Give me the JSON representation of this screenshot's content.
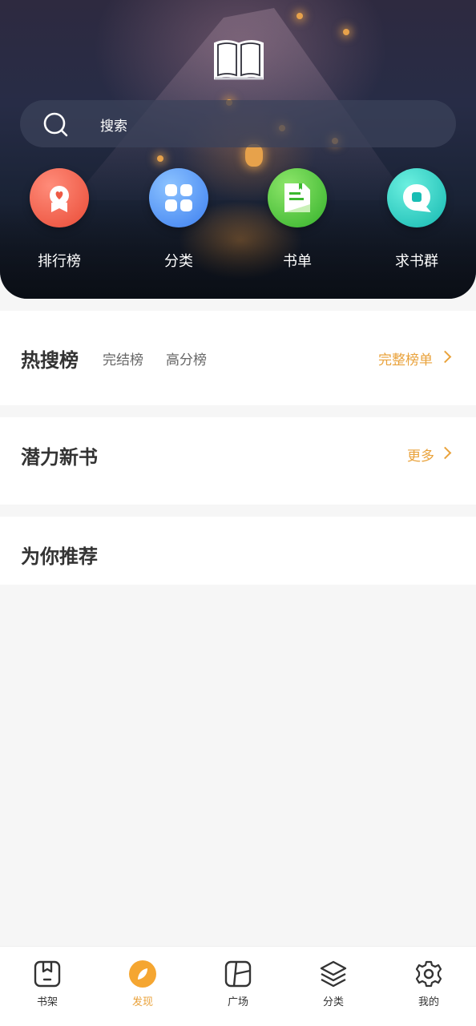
{
  "search": {
    "placeholder": "搜索"
  },
  "quick_entries": [
    {
      "label": "排行榜",
      "icon": "ranking-badge-icon",
      "color": "#e94b36"
    },
    {
      "label": "分类",
      "icon": "category-grid-icon",
      "color": "#3d7ff0"
    },
    {
      "label": "书单",
      "icon": "booklist-icon",
      "color": "#33b12a"
    },
    {
      "label": "求书群",
      "icon": "chat-bubble-icon",
      "color": "#14b8b0"
    }
  ],
  "ranking": {
    "active_tab": "热搜榜",
    "tabs": [
      "完结榜",
      "高分榜"
    ],
    "more": "完整榜单"
  },
  "potential": {
    "title": "潜力新书",
    "more": "更多"
  },
  "recommend": {
    "title": "为你推荐"
  },
  "tabbar": [
    {
      "label": "书架",
      "icon": "bookshelf-icon"
    },
    {
      "label": "发现",
      "icon": "compass-icon",
      "active": true
    },
    {
      "label": "广场",
      "icon": "square-icon"
    },
    {
      "label": "分类",
      "icon": "layers-icon"
    },
    {
      "label": "我的",
      "icon": "gear-icon"
    }
  ],
  "colors": {
    "accent": "#e9a23b",
    "text": "#333333",
    "sub": "#666666",
    "background": "#f6f6f6"
  }
}
